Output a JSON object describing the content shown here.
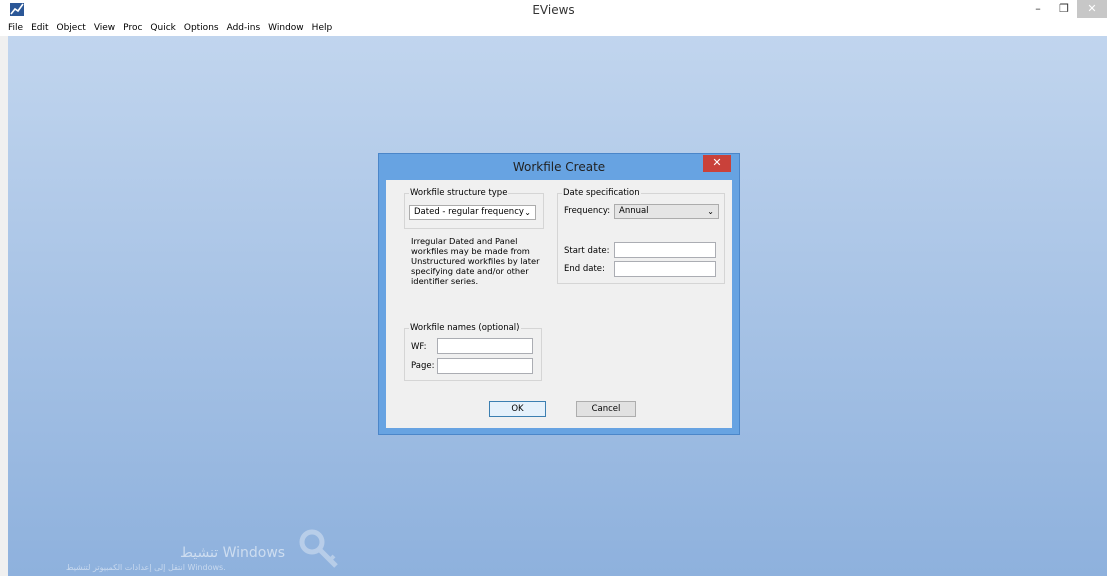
{
  "window": {
    "title": "EViews",
    "minimize": "–",
    "restore": "❐",
    "close": "✕"
  },
  "menubar": [
    "File",
    "Edit",
    "Object",
    "View",
    "Proc",
    "Quick",
    "Options",
    "Add-ins",
    "Window",
    "Help"
  ],
  "dialog": {
    "title": "Workfile Create",
    "close": "✕",
    "structure": {
      "label": "Workfile structure type",
      "selected": "Dated - regular frequency"
    },
    "note": "Irregular Dated and Panel workfiles may be made from Unstructured workfiles by later specifying date and/or other identifier series.",
    "date_spec": {
      "label": "Date specification",
      "frequency_label": "Frequency:",
      "frequency_selected": "Annual",
      "start_label": "Start date:",
      "start_value": "",
      "end_label": "End date:",
      "end_value": ""
    },
    "names": {
      "label": "Workfile names (optional)",
      "wf_label": "WF:",
      "wf_value": "",
      "page_label": "Page:",
      "page_value": ""
    },
    "ok_label": "OK",
    "cancel_label": "Cancel"
  },
  "watermark": {
    "line1": "تنشيط Windows",
    "line2": "انتقل إلى إعدادات الكمبيوتر لتنشيط Windows."
  }
}
